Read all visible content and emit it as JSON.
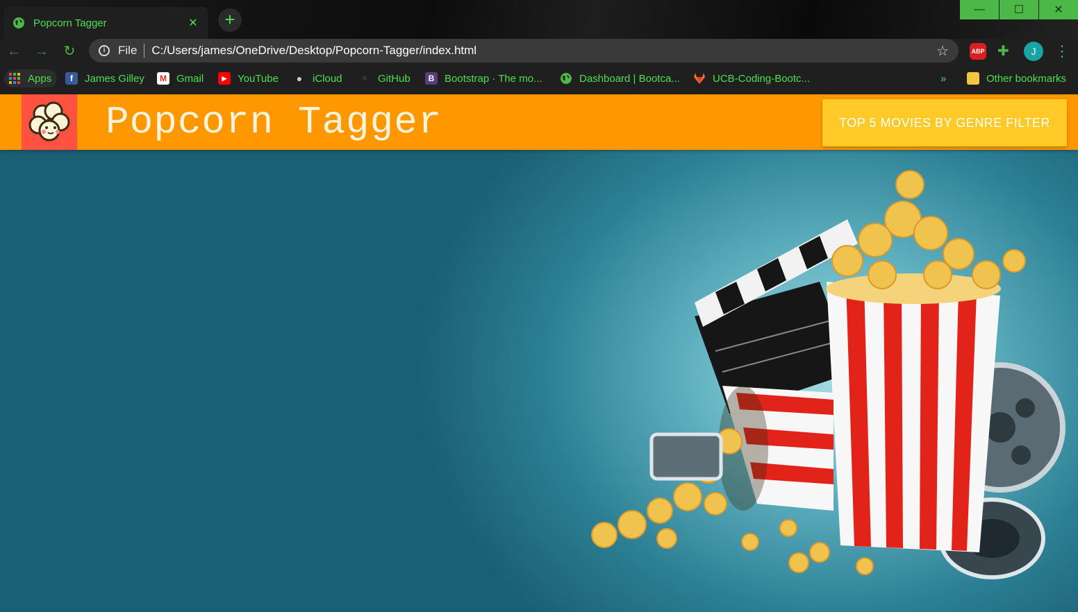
{
  "browser": {
    "tab": {
      "title": "Popcorn Tagger",
      "close_label": "✕"
    },
    "new_tab_label": "+",
    "window_controls": {
      "minimize": "—",
      "maximize": "☐",
      "close": "✕"
    },
    "address_bar": {
      "scheme": "File",
      "url": "C:/Users/james/OneDrive/Desktop/Popcorn-Tagger/index.html"
    },
    "extensions": {
      "abp": "ABP",
      "profile_initial": "J"
    },
    "bookmarks": [
      {
        "label": "Apps",
        "icon": "apps-grid-icon"
      },
      {
        "label": "James Gilley",
        "icon": "facebook-icon"
      },
      {
        "label": "Gmail",
        "icon": "gmail-icon"
      },
      {
        "label": "YouTube",
        "icon": "youtube-icon"
      },
      {
        "label": "iCloud",
        "icon": "apple-icon"
      },
      {
        "label": "GitHub",
        "icon": "github-icon"
      },
      {
        "label": "Bootstrap · The mo...",
        "icon": "bootstrap-icon"
      },
      {
        "label": "Dashboard | Bootca...",
        "icon": "globe-icon"
      },
      {
        "label": "UCB-Coding-Bootc...",
        "icon": "gitlab-icon"
      }
    ],
    "bookmarks_overflow": "»",
    "other_bookmarks": "Other bookmarks"
  },
  "page": {
    "brand": "Popcorn Tagger",
    "nav_button": "TOP 5 MOVIES BY GENRE FILTER"
  },
  "colors": {
    "navbar": "#ff9800",
    "logo_bg": "#ff5240",
    "button": "#ffca28",
    "chrome_accent": "#4ce04c"
  }
}
